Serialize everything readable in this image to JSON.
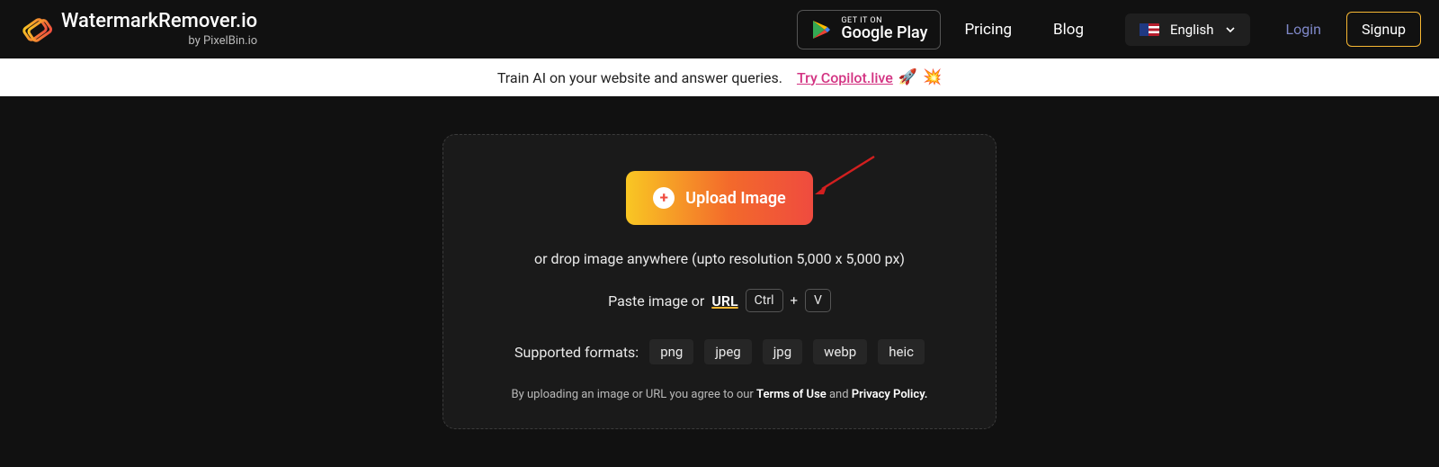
{
  "header": {
    "brand_main": "WatermarkRemover.io",
    "brand_sub": "by PixelBin.io",
    "play_top": "GET IT ON",
    "play_bottom": "Google Play",
    "nav_pricing": "Pricing",
    "nav_blog": "Blog",
    "language": "English",
    "login": "Login",
    "signup": "Signup"
  },
  "banner": {
    "text": "Train AI on your website and answer queries.",
    "link": "Try Copilot.live",
    "emoji1": "🚀",
    "emoji2": "💥"
  },
  "card": {
    "upload": "Upload Image",
    "drop_hint": "or drop image anywhere (upto resolution 5,000 x 5,000 px)",
    "paste_prefix": "Paste image or",
    "paste_url": "URL",
    "key_ctrl": "Ctrl",
    "key_plus": "+",
    "key_v": "V",
    "formats_label": "Supported formats:",
    "formats": {
      "f0": "png",
      "f1": "jpeg",
      "f2": "jpg",
      "f3": "webp",
      "f4": "heic"
    },
    "agree_prefix": "By uploading an image or URL you agree to our ",
    "agree_terms": "Terms of Use",
    "agree_and": " and ",
    "agree_privacy": "Privacy Policy."
  }
}
